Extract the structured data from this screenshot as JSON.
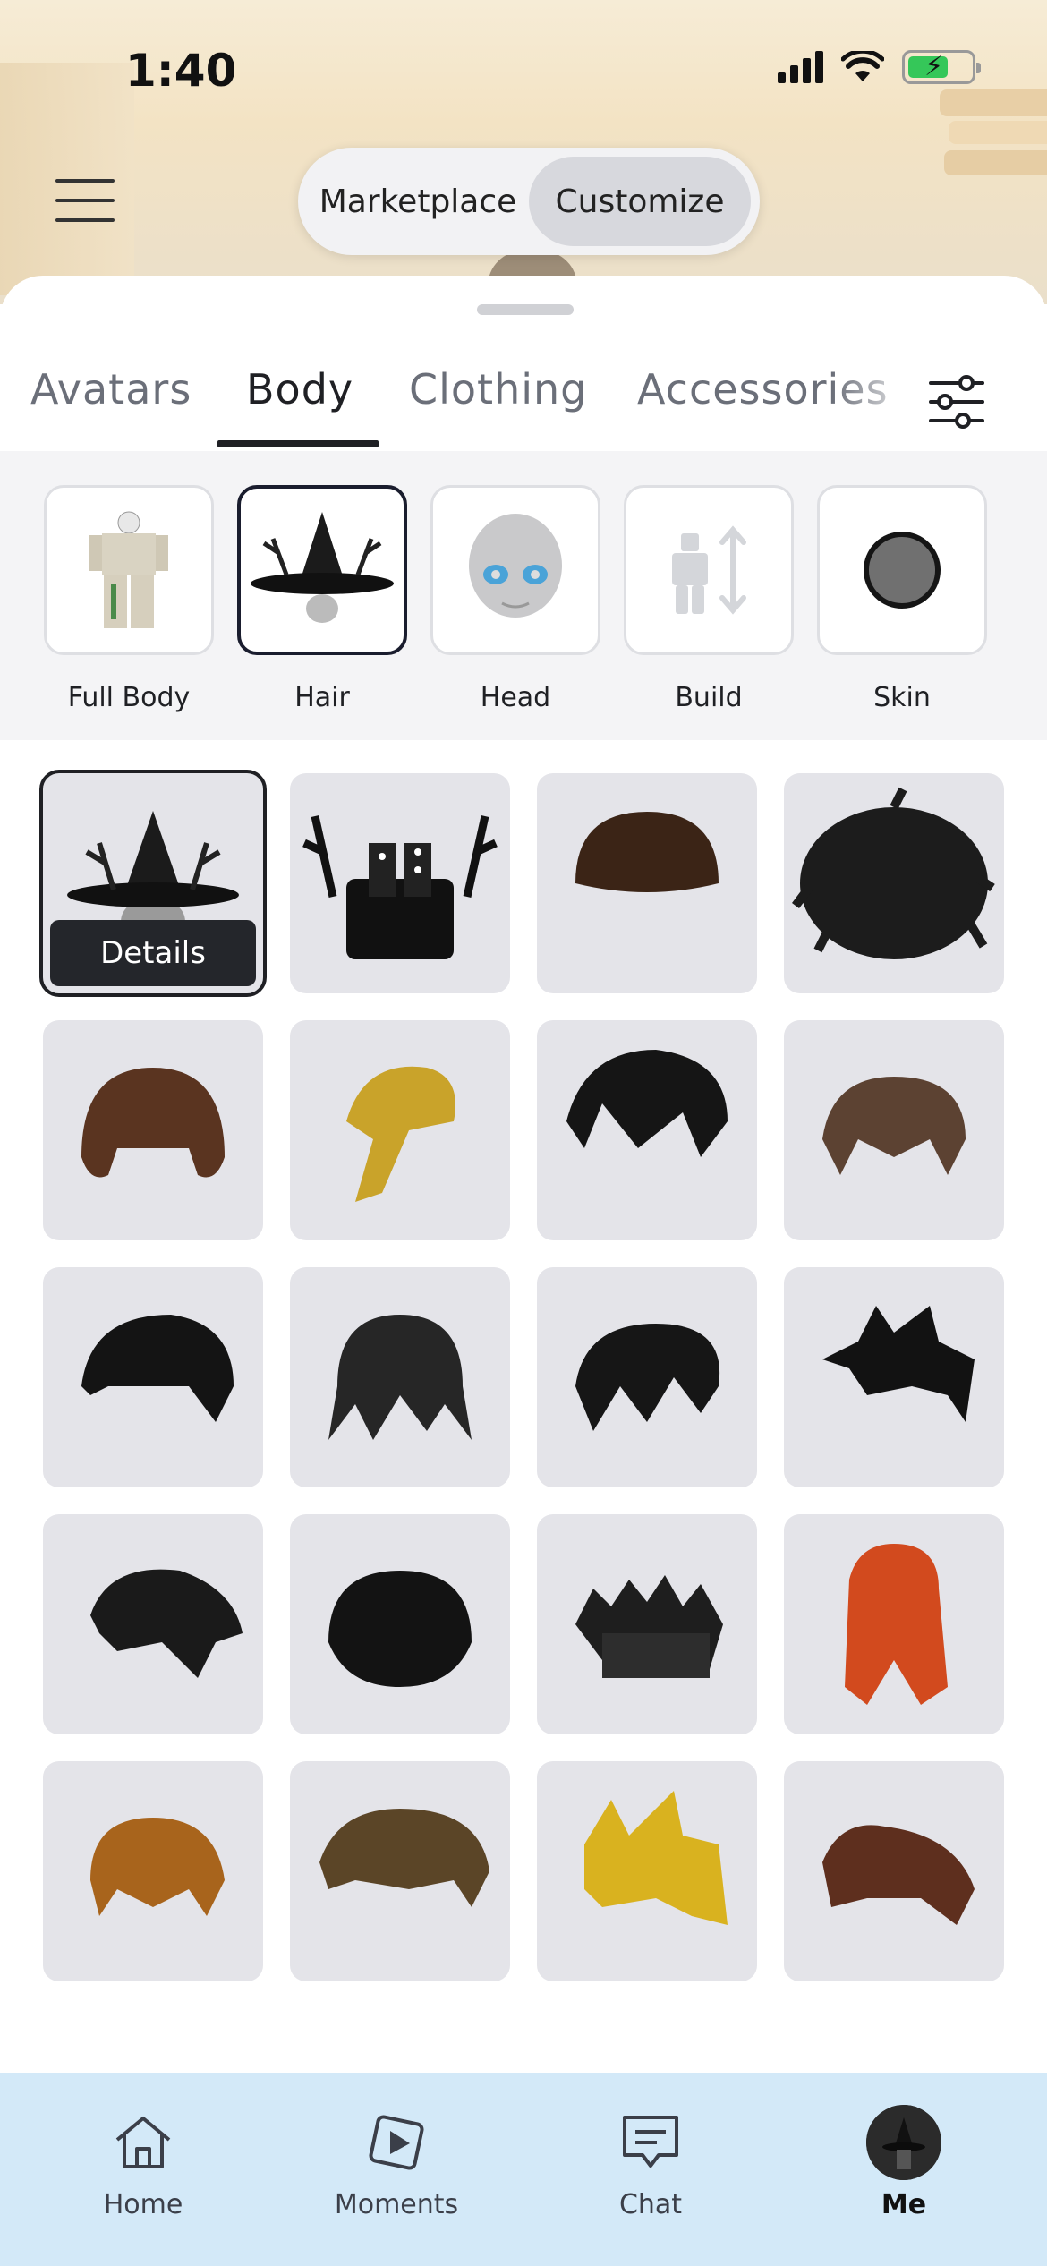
{
  "status_bar": {
    "time": "1:40"
  },
  "header": {
    "segments": [
      {
        "label": "Marketplace",
        "active": false
      },
      {
        "label": "Customize",
        "active": true
      }
    ]
  },
  "tabs": [
    {
      "label": "Avatars",
      "active": false
    },
    {
      "label": "Body",
      "active": true
    },
    {
      "label": "Clothing",
      "active": false
    },
    {
      "label": "Accessories",
      "active": false
    }
  ],
  "categories": [
    {
      "label": "Full Body",
      "icon": "full-body-icon",
      "active": false
    },
    {
      "label": "Hair",
      "icon": "hair-icon",
      "active": true
    },
    {
      "label": "Head",
      "icon": "head-icon",
      "active": false
    },
    {
      "label": "Build",
      "icon": "build-icon",
      "active": false
    },
    {
      "label": "Skin",
      "icon": "skin-icon",
      "active": false
    }
  ],
  "items": [
    {
      "name": "witch-hat-hair",
      "color": "#1b1b1b",
      "selected": true
    },
    {
      "name": "antler-dice-hair",
      "color": "#111111"
    },
    {
      "name": "brown-bowl-hair",
      "color": "#3b2416"
    },
    {
      "name": "messy-black-hair",
      "color": "#1c1c1c"
    },
    {
      "name": "brown-curly-hair",
      "color": "#5a3420"
    },
    {
      "name": "blonde-ponytail-hair",
      "color": "#c9a32a"
    },
    {
      "name": "black-swoop-hair",
      "color": "#151515"
    },
    {
      "name": "brown-shag-hair",
      "color": "#5c4232"
    },
    {
      "name": "black-side-part-hair",
      "color": "#141414"
    },
    {
      "name": "black-emo-hair",
      "color": "#262626"
    },
    {
      "name": "black-fringe-hair",
      "color": "#161616"
    },
    {
      "name": "black-spiky-hair",
      "color": "#121212"
    },
    {
      "name": "black-windswept-hair",
      "color": "#1a1a1a"
    },
    {
      "name": "black-curly-hair",
      "color": "#131313"
    },
    {
      "name": "black-mohawk-hair",
      "color": "#1e1e1e"
    },
    {
      "name": "orange-braided-hair",
      "color": "#d24a1e"
    },
    {
      "name": "ginger-messy-hair",
      "color": "#a8641c"
    },
    {
      "name": "brown-tousled-hair",
      "color": "#5b4527"
    },
    {
      "name": "golden-spiky-hair",
      "color": "#d9b21f"
    },
    {
      "name": "brown-swept-hair",
      "color": "#5e2f1e"
    }
  ],
  "item_action": {
    "details_label": "Details"
  },
  "bottom_nav": [
    {
      "label": "Home",
      "icon": "home-icon",
      "active": false
    },
    {
      "label": "Moments",
      "icon": "moments-play-icon",
      "active": false
    },
    {
      "label": "Chat",
      "icon": "chat-icon",
      "active": false
    },
    {
      "label": "Me",
      "icon": "avatar",
      "active": true
    }
  ]
}
